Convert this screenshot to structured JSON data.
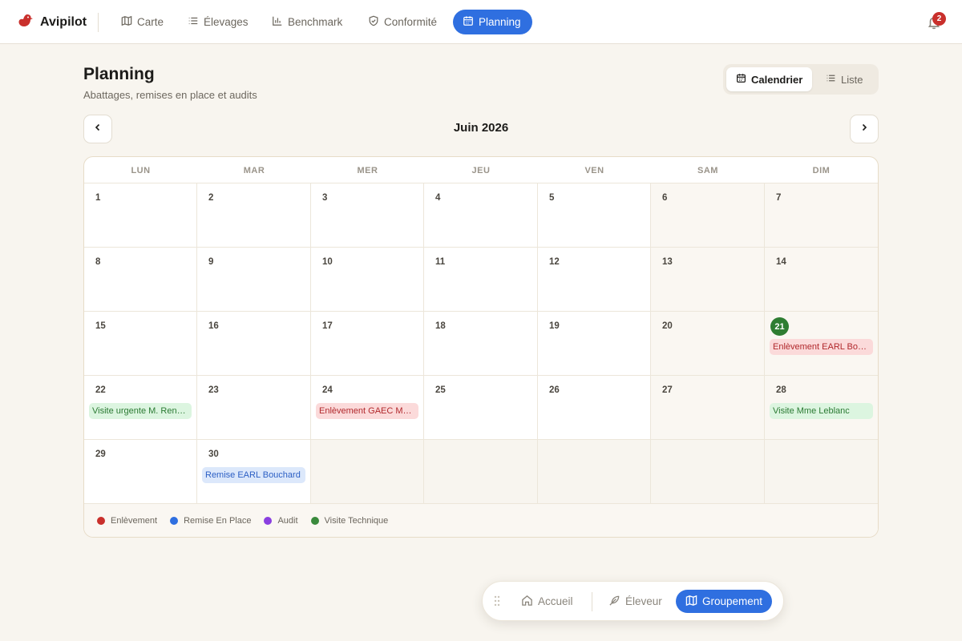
{
  "app": {
    "name": "Avipilot"
  },
  "nav": {
    "items": [
      {
        "label": "Carte",
        "icon": "map-icon"
      },
      {
        "label": "Élevages",
        "icon": "list-icon"
      },
      {
        "label": "Benchmark",
        "icon": "bar-chart-icon"
      },
      {
        "label": "Conformité",
        "icon": "shield-icon"
      },
      {
        "label": "Planning",
        "icon": "calendar-icon",
        "active": true
      }
    ],
    "notifications_count": "2"
  },
  "page": {
    "title": "Planning",
    "subtitle": "Abattages, remises en place et audits"
  },
  "view_toggle": {
    "calendar": "Calendrier",
    "list": "Liste",
    "selected": "calendar"
  },
  "month": {
    "label": "Juin 2026"
  },
  "calendar": {
    "weekdays": [
      "LUN",
      "MAR",
      "MER",
      "JEU",
      "VEN",
      "SAM",
      "DIM"
    ],
    "today": "21",
    "events": {
      "day21": "Enlèvement EARL Bouchard",
      "day22": "Visite urgente M. Renaud",
      "day24": "Enlèvement GAEC Martin",
      "day28": "Visite Mme Leblanc",
      "day30": "Remise EARL Bouchard"
    }
  },
  "legend": [
    {
      "label": "Enlèvement",
      "color": "#c9302c"
    },
    {
      "label": "Remise En Place",
      "color": "#2f6fe0"
    },
    {
      "label": "Audit",
      "color": "#8a3fe0"
    },
    {
      "label": "Visite Technique",
      "color": "#3a8a3c"
    }
  ],
  "dock": {
    "accueil": "Accueil",
    "eleveur": "Éleveur",
    "groupement": "Groupement",
    "selected": "groupement"
  }
}
